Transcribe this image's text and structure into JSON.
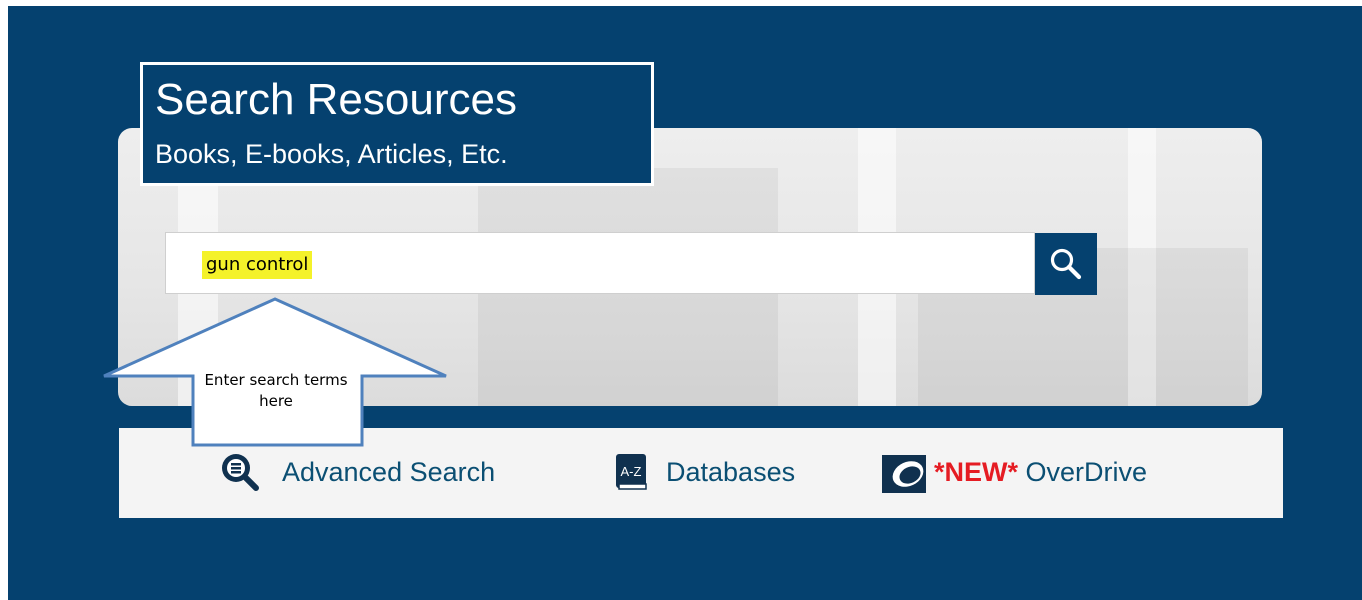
{
  "title": {
    "main": "Search Resources",
    "subtitle": "Books, E-books, Articles, Etc."
  },
  "search": {
    "value": "gun control",
    "button_icon": "search-icon"
  },
  "callout": {
    "text": "Enter search terms here"
  },
  "links": {
    "advanced_search": {
      "label": "Advanced Search",
      "icon": "advanced-search-icon"
    },
    "databases": {
      "label": "Databases",
      "icon": "a-z-book-icon",
      "icon_text": "A-Z"
    },
    "overdrive": {
      "new_tag": "*NEW*",
      "label": " OverDrive",
      "icon": "overdrive-icon"
    }
  },
  "colors": {
    "brand_navy": "#05416f",
    "highlight": "#f4f22a",
    "new_red": "#e51c23",
    "callout_border": "#4f81bd"
  }
}
